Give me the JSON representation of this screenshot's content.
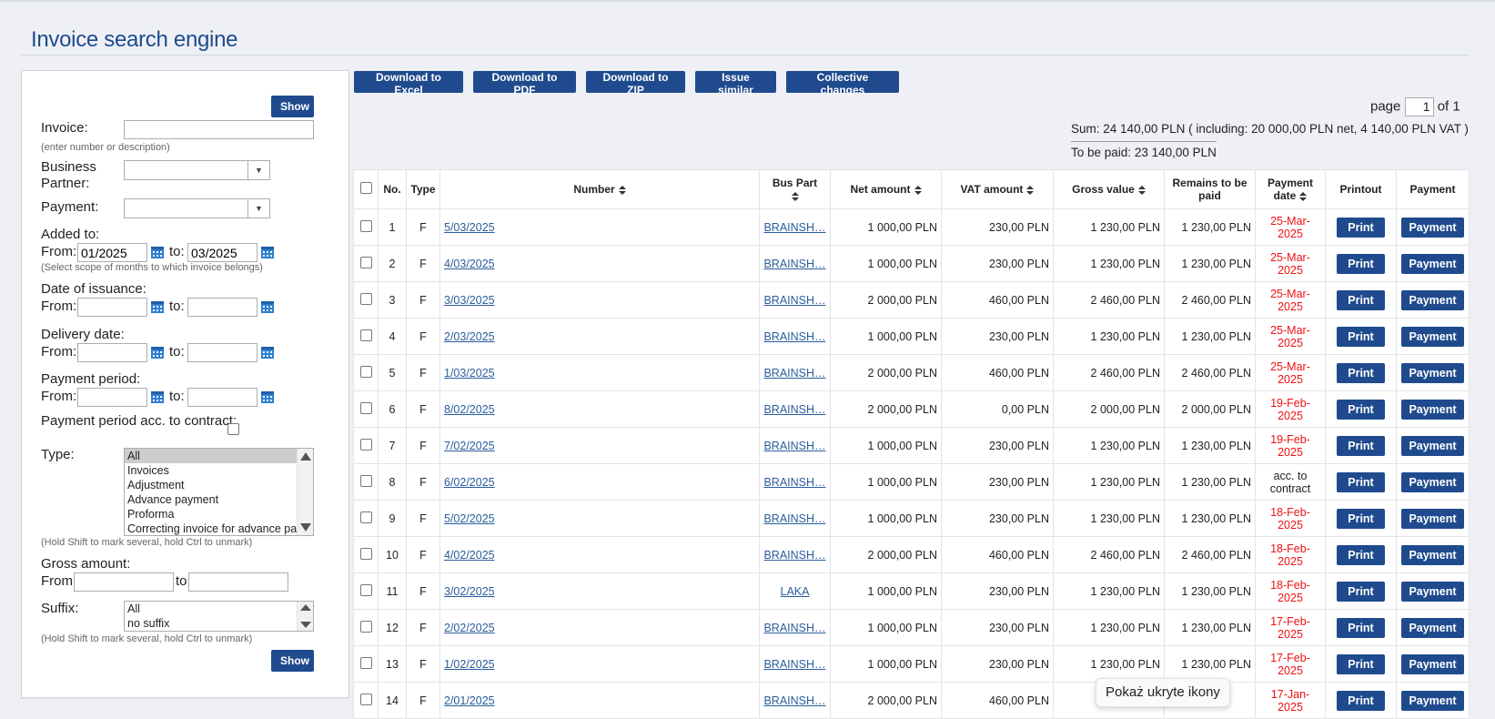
{
  "page": {
    "title": "Invoice search engine"
  },
  "filters": {
    "show_label": "Show",
    "invoice": {
      "label": "Invoice:",
      "value": "",
      "hint": "(enter number or description)"
    },
    "business_partner": {
      "label": "Business Partner:",
      "value": ""
    },
    "payment": {
      "label": "Payment:",
      "value": ""
    },
    "added_to": {
      "label": "Added to:",
      "from_label": "From:",
      "to_label": "to:",
      "from": "01/2025",
      "to": "03/2025",
      "hint": "(Select scope of months to which invoice belongs)"
    },
    "date_of_issuance": {
      "label": "Date of issuance:",
      "from_label": "From:",
      "to_label": "to:",
      "from": "",
      "to": ""
    },
    "delivery_date": {
      "label": "Delivery date:",
      "from_label": "From:",
      "to_label": "to:",
      "from": "",
      "to": ""
    },
    "payment_period": {
      "label": "Payment period:",
      "from_label": "From:",
      "to_label": "to:",
      "from": "",
      "to": ""
    },
    "payment_period_contract": {
      "label": "Payment period acc. to contract:"
    },
    "type": {
      "label": "Type:",
      "options": [
        "All",
        "Invoices",
        "Adjustment",
        "Advance payment",
        "Proforma",
        "Correcting invoice for advance payn"
      ],
      "selected": "All",
      "hint": "(Hold Shift to mark several, hold Ctrl to unmark)"
    },
    "gross_amount": {
      "label": "Gross amount:",
      "from_label": "From:",
      "to_label": "to:",
      "from": "",
      "to": ""
    },
    "suffix": {
      "label": "Suffix:",
      "options": [
        "All",
        "no suffix"
      ],
      "hint": "(Hold Shift to mark several, hold Ctrl to unmark)"
    }
  },
  "toolbar": {
    "excel": "Download to Excel",
    "pdf": "Download to PDF",
    "zip": "Download to ZIP",
    "similar": "Issue similar",
    "collective": "Collective changes"
  },
  "pagination": {
    "label": "page",
    "current": "1",
    "of_label": "of 1"
  },
  "summary": {
    "sum_label": "Sum:",
    "sum_value": "24 140,00 PLN",
    "sum_detail": "( including: 20 000,00 PLN net, 4 140,00 PLN VAT )",
    "to_pay_label": "To be paid:",
    "to_pay_value": "23 140,00 PLN"
  },
  "table": {
    "headers": {
      "no": "No.",
      "type": "Type",
      "number": "Number",
      "bus_part": "Bus Part",
      "net": "Net amount",
      "vat": "VAT amount",
      "gross": "Gross value",
      "remains": "Remains to be paid",
      "payment_date": "Payment date",
      "printout": "Printout",
      "payment": "Payment"
    },
    "print_label": "Print",
    "payment_label": "Payment",
    "rows": [
      {
        "no": "1",
        "type": "F",
        "number": "5/03/2025",
        "bp": "BRAINSH…",
        "net": "1 000,00 PLN",
        "vat": "230,00 PLN",
        "gross": "1 230,00 PLN",
        "remains": "1 230,00 PLN",
        "date": "25-Mar-2025",
        "overdue": true
      },
      {
        "no": "2",
        "type": "F",
        "number": "4/03/2025",
        "bp": "BRAINSH…",
        "net": "1 000,00 PLN",
        "vat": "230,00 PLN",
        "gross": "1 230,00 PLN",
        "remains": "1 230,00 PLN",
        "date": "25-Mar-2025",
        "overdue": true
      },
      {
        "no": "3",
        "type": "F",
        "number": "3/03/2025",
        "bp": "BRAINSH…",
        "net": "2 000,00 PLN",
        "vat": "460,00 PLN",
        "gross": "2 460,00 PLN",
        "remains": "2 460,00 PLN",
        "date": "25-Mar-2025",
        "overdue": true
      },
      {
        "no": "4",
        "type": "F",
        "number": "2/03/2025",
        "bp": "BRAINSH…",
        "net": "1 000,00 PLN",
        "vat": "230,00 PLN",
        "gross": "1 230,00 PLN",
        "remains": "1 230,00 PLN",
        "date": "25-Mar-2025",
        "overdue": true
      },
      {
        "no": "5",
        "type": "F",
        "number": "1/03/2025",
        "bp": "BRAINSH…",
        "net": "2 000,00 PLN",
        "vat": "460,00 PLN",
        "gross": "2 460,00 PLN",
        "remains": "2 460,00 PLN",
        "date": "25-Mar-2025",
        "overdue": true
      },
      {
        "no": "6",
        "type": "F",
        "number": "8/02/2025",
        "bp": "BRAINSH…",
        "net": "2 000,00 PLN",
        "vat": "0,00 PLN",
        "gross": "2 000,00 PLN",
        "remains": "2 000,00 PLN",
        "date": "19-Feb-2025",
        "overdue": true
      },
      {
        "no": "7",
        "type": "F",
        "number": "7/02/2025",
        "bp": "BRAINSH…",
        "net": "1 000,00 PLN",
        "vat": "230,00 PLN",
        "gross": "1 230,00 PLN",
        "remains": "1 230,00 PLN",
        "date": "19-Feb-2025",
        "overdue": true
      },
      {
        "no": "8",
        "type": "F",
        "number": "6/02/2025",
        "bp": "BRAINSH…",
        "net": "1 000,00 PLN",
        "vat": "230,00 PLN",
        "gross": "1 230,00 PLN",
        "remains": "1 230,00 PLN",
        "date": "acc. to contract",
        "overdue": false
      },
      {
        "no": "9",
        "type": "F",
        "number": "5/02/2025",
        "bp": "BRAINSH…",
        "net": "1 000,00 PLN",
        "vat": "230,00 PLN",
        "gross": "1 230,00 PLN",
        "remains": "1 230,00 PLN",
        "date": "18-Feb-2025",
        "overdue": true
      },
      {
        "no": "10",
        "type": "F",
        "number": "4/02/2025",
        "bp": "BRAINSH…",
        "net": "2 000,00 PLN",
        "vat": "460,00 PLN",
        "gross": "2 460,00 PLN",
        "remains": "2 460,00 PLN",
        "date": "18-Feb-2025",
        "overdue": true
      },
      {
        "no": "11",
        "type": "F",
        "number": "3/02/2025",
        "bp": "LAKA",
        "net": "1 000,00 PLN",
        "vat": "230,00 PLN",
        "gross": "1 230,00 PLN",
        "remains": "1 230,00 PLN",
        "date": "18-Feb-2025",
        "overdue": true
      },
      {
        "no": "12",
        "type": "F",
        "number": "2/02/2025",
        "bp": "BRAINSH…",
        "net": "1 000,00 PLN",
        "vat": "230,00 PLN",
        "gross": "1 230,00 PLN",
        "remains": "1 230,00 PLN",
        "date": "17-Feb-2025",
        "overdue": true
      },
      {
        "no": "13",
        "type": "F",
        "number": "1/02/2025",
        "bp": "BRAINSH…",
        "net": "1 000,00 PLN",
        "vat": "230,00 PLN",
        "gross": "1 230,00 PLN",
        "remains": "1 230,00 PLN",
        "date": "17-Feb-2025",
        "overdue": true
      },
      {
        "no": "14",
        "type": "F",
        "number": "2/01/2025",
        "bp": "BRAINSH…",
        "net": "2 000,00 PLN",
        "vat": "460,00 PLN",
        "gross": "",
        "remains": "",
        "date": "17-Jan-2025",
        "overdue": true
      }
    ]
  },
  "tooltip": {
    "text": "Pokaż ukryte ikony"
  },
  "colors": {
    "accent": "#1f4b8e",
    "title": "#1e4b8f",
    "overdue": "#e11111",
    "link": "#2a5d9c"
  }
}
